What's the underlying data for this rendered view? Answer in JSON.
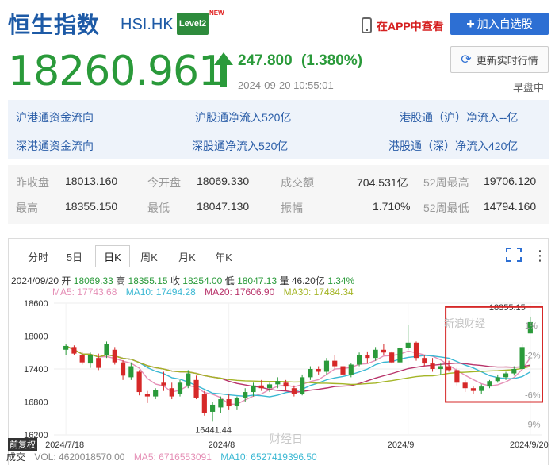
{
  "header": {
    "title": "恒生指数",
    "code": "HSI.HK",
    "level2_badge": "Level2",
    "new_tag": "NEW",
    "app_link": "在APP中查看",
    "add_button": "加入自选股"
  },
  "quote": {
    "price": "18260.961",
    "change": "247.800",
    "change_pct": "(1.380%)",
    "datetime": "2024-09-20 10:55:01",
    "refresh_button": "更新实时行情",
    "session": "早盘中",
    "direction": "up",
    "color_up": "#2a9a3a"
  },
  "flow": {
    "sh_hk_label": "沪港通资金流向",
    "sz_hk_label": "深港通资金流向",
    "sh_inflow": "沪股通净流入520亿",
    "sz_inflow": "深股通净流入520亿",
    "hk_sh_inflow": "港股通（沪）净流入--亿",
    "hk_sz_inflow": "港股通（深）净流入420亿"
  },
  "stats": {
    "prev_close_label": "昨收盘",
    "prev_close": "18013.160",
    "open_label": "今开盘",
    "open": "18069.330",
    "turnover_label": "成交额",
    "turnover": "704.531亿",
    "w52_high_label": "52周最高",
    "w52_high": "19706.120",
    "high_label": "最高",
    "high": "18355.150",
    "low_label": "最低",
    "low": "18047.130",
    "amplitude_label": "振幅",
    "amplitude": "1.710%",
    "w52_low_label": "52周最低",
    "w52_low": "14794.160"
  },
  "tabs": [
    "分时",
    "5日",
    "日K",
    "周K",
    "月K",
    "年K"
  ],
  "active_tab": "日K",
  "ohlc": {
    "date": "2024/09/20",
    "open_label": "开",
    "open": "18069.33",
    "high_label": "高",
    "high": "18355.15",
    "close_label": "收",
    "close": "18254.00",
    "low_label": "低",
    "low": "18047.13",
    "vol_label": "量",
    "vol": "46.20亿",
    "pct": "1.34%"
  },
  "ma": {
    "ma5": "MA5: 17743.68",
    "ma10": "MA10: 17494.28",
    "ma20": "MA20: 17606.90",
    "ma30": "MA30: 17484.34",
    "colors": {
      "ma5": "#e58fb6",
      "ma10": "#3bb8d3",
      "ma20": "#b8336a",
      "ma30": "#a4b526"
    }
  },
  "chart_data": {
    "type": "candlestick",
    "y_ticks": [
      "18600",
      "18000",
      "17400",
      "16800",
      "16200"
    ],
    "y_ticks_right": [
      "1%",
      "-2%",
      "-6%",
      "-9%"
    ],
    "x_ticks": [
      "2024/7/18",
      "2024/8",
      "2024/9",
      "2024/9/20"
    ],
    "ylim": [
      16200,
      18600
    ],
    "max_label": "18355.15",
    "min_label": "16441.44",
    "candles": [
      [
        17750,
        17850,
        17650,
        17820
      ],
      [
        17800,
        17830,
        17650,
        17680
      ],
      [
        17650,
        17720,
        17480,
        17520
      ],
      [
        17500,
        17700,
        17420,
        17650
      ],
      [
        17600,
        17680,
        17380,
        17420
      ],
      [
        17650,
        17900,
        17600,
        17850
      ],
      [
        17750,
        17800,
        17480,
        17520
      ],
      [
        17520,
        17560,
        17200,
        17280
      ],
      [
        17250,
        17520,
        17200,
        17450
      ],
      [
        17350,
        17380,
        16920,
        16980
      ],
      [
        16950,
        17000,
        16780,
        16900
      ],
      [
        16900,
        17050,
        16850,
        17020
      ],
      [
        17150,
        17350,
        17000,
        17100
      ],
      [
        17050,
        17150,
        16850,
        16900
      ],
      [
        16950,
        17200,
        16900,
        17150
      ],
      [
        17100,
        17380,
        17050,
        17320
      ],
      [
        17200,
        17280,
        16850,
        16880
      ],
      [
        16950,
        17000,
        16550,
        16600
      ],
      [
        16620,
        16800,
        16441,
        16750
      ],
      [
        16700,
        16900,
        16600,
        16850
      ],
      [
        16850,
        16950,
        16650,
        16720
      ],
      [
        16720,
        16900,
        16650,
        16880
      ],
      [
        16880,
        17050,
        16800,
        16980
      ],
      [
        16980,
        17150,
        16900,
        17100
      ],
      [
        17100,
        17200,
        17000,
        17050
      ],
      [
        17050,
        17150,
        16980,
        17120
      ],
      [
        17120,
        17250,
        17050,
        17180
      ],
      [
        17150,
        17200,
        17000,
        17080
      ],
      [
        17050,
        17100,
        16900,
        16950
      ],
      [
        16950,
        17300,
        16920,
        17250
      ],
      [
        17250,
        17450,
        17200,
        17400
      ],
      [
        17400,
        17450,
        17300,
        17350
      ],
      [
        17350,
        17600,
        17300,
        17550
      ],
      [
        17550,
        17650,
        17400,
        17450
      ],
      [
        17450,
        17500,
        17250,
        17300
      ],
      [
        17300,
        17500,
        17250,
        17480
      ],
      [
        17480,
        17700,
        17450,
        17650
      ],
      [
        17650,
        17720,
        17500,
        17600
      ],
      [
        17600,
        17800,
        17550,
        17750
      ],
      [
        17750,
        17850,
        17650,
        17700
      ],
      [
        17700,
        17720,
        17500,
        17520
      ],
      [
        17520,
        17800,
        17500,
        17780
      ],
      [
        17780,
        18200,
        17750,
        17880
      ],
      [
        17880,
        17900,
        17550,
        17600
      ],
      [
        17600,
        17650,
        17450,
        17500
      ],
      [
        17500,
        17600,
        17350,
        17400
      ],
      [
        17400,
        17500,
        17300,
        17450
      ],
      [
        17450,
        17550,
        17350,
        17380
      ],
      [
        17380,
        17420,
        17100,
        17150
      ],
      [
        17150,
        17200,
        16980,
        17050
      ],
      [
        17050,
        17080,
        16950,
        17000
      ],
      [
        17000,
        17120,
        16950,
        17080
      ],
      [
        17080,
        17200,
        17050,
        17180
      ],
      [
        17180,
        17300,
        17150,
        17250
      ],
      [
        17250,
        17350,
        17200,
        17320
      ],
      [
        17320,
        17450,
        17280,
        17400
      ],
      [
        17400,
        17850,
        17380,
        17800
      ],
      [
        18047,
        18355,
        18047,
        18254
      ]
    ]
  },
  "volume": {
    "label": "成交",
    "vol": "VOL: 4620018570.00",
    "ma5": "MA5: 6716553091",
    "ma10": "MA10: 6527419396.50"
  },
  "fuquan": "前复权",
  "watermark": {
    "text1": "新浪财经",
    "text2": "财经日"
  }
}
